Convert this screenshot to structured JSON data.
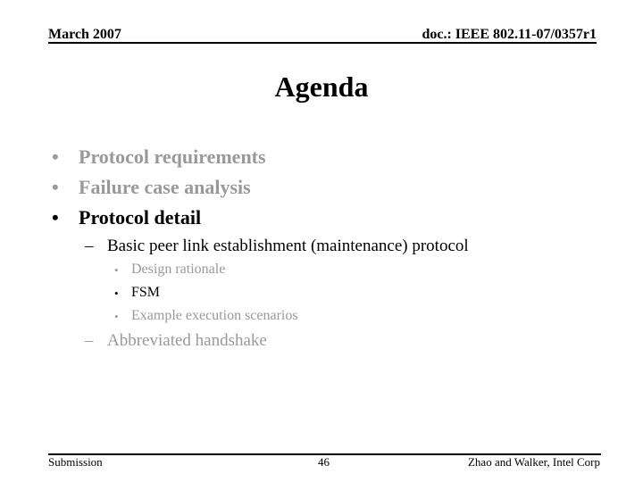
{
  "header": {
    "date": "March 2007",
    "doc_id": "doc.: IEEE 802.11-07/0357r1"
  },
  "title": "Agenda",
  "colors": {
    "active": "#000000",
    "dimmed": "#999999"
  },
  "bullets": [
    {
      "marker": "•",
      "text": "Protocol requirements",
      "state": "dimmed"
    },
    {
      "marker": "•",
      "text": "Failure case analysis",
      "state": "dimmed"
    },
    {
      "marker": "•",
      "text": "Protocol detail",
      "state": "active",
      "children": [
        {
          "marker": "–",
          "text": "Basic peer link establishment (maintenance) protocol",
          "state": "active",
          "children": [
            {
              "marker": "•",
              "text": "Design rationale",
              "state": "dimmed"
            },
            {
              "marker": "•",
              "text": "FSM",
              "state": "active"
            },
            {
              "marker": "•",
              "text": "Example execution scenarios",
              "state": "dimmed"
            }
          ]
        },
        {
          "marker": "–",
          "text": "Abbreviated handshake",
          "state": "dimmed"
        }
      ]
    }
  ],
  "footer": {
    "left": "Submission",
    "page": "46",
    "right": "Zhao and Walker, Intel Corp"
  }
}
